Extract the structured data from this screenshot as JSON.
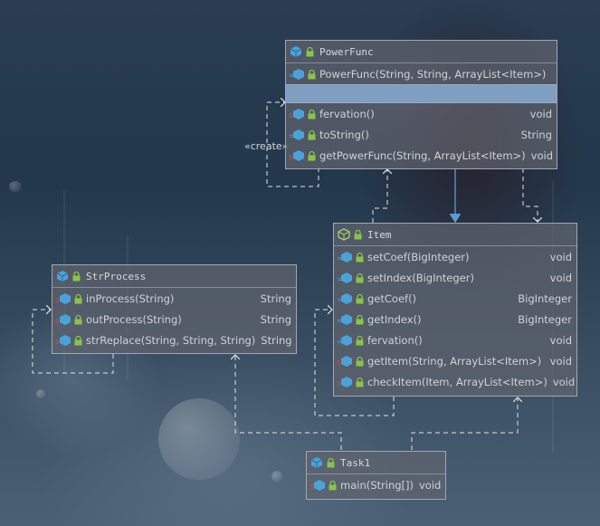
{
  "diagram": {
    "classes": {
      "powerfunc": {
        "name": "PowerFunc",
        "constructor": "PowerFunc(String, String, ArrayList<Item>)",
        "methods": [
          {
            "sig": "fervation()",
            "ret": "void"
          },
          {
            "sig": "toString()",
            "ret": "String"
          },
          {
            "sig": "getPowerFunc(String, ArrayList<Item>)",
            "ret": "void"
          }
        ]
      },
      "item": {
        "name": "Item",
        "methods": [
          {
            "sig": "setCoef(BigInteger)",
            "ret": "void"
          },
          {
            "sig": "setIndex(BigInteger)",
            "ret": "void"
          },
          {
            "sig": "getCoef()",
            "ret": "BigInteger"
          },
          {
            "sig": "getIndex()",
            "ret": "BigInteger"
          },
          {
            "sig": "fervation()",
            "ret": "void"
          },
          {
            "sig": "getItem(String, ArrayList<Item>)",
            "ret": "void"
          },
          {
            "sig": "checkItem(Item, ArrayList<Item>)",
            "ret": "void"
          }
        ]
      },
      "strprocess": {
        "name": "StrProcess",
        "methods": [
          {
            "sig": "inProcess(String)",
            "ret": "String"
          },
          {
            "sig": "outProcess(String)",
            "ret": "String"
          },
          {
            "sig": "strReplace(String, String, String)",
            "ret": "String"
          }
        ]
      },
      "task1": {
        "name": "Task1",
        "methods": [
          {
            "sig": "main(String[])",
            "ret": "void"
          }
        ]
      }
    },
    "create_label": "«create»",
    "colors": {
      "class_icon": "#4aa3d8",
      "interface_icon": "#8bc34a",
      "lock_icon": "#8bc34a",
      "constructor_icon": "#4aa3d8",
      "arrow_solid": "#5b9bd5",
      "arrow_dashed": "#dfe3e8",
      "selected_section": "#7e9ec2"
    },
    "icons": [
      "class-icon",
      "item-class-icon",
      "lock-icon",
      "method-icon",
      "static-method-icon",
      "constructor-icon"
    ]
  }
}
